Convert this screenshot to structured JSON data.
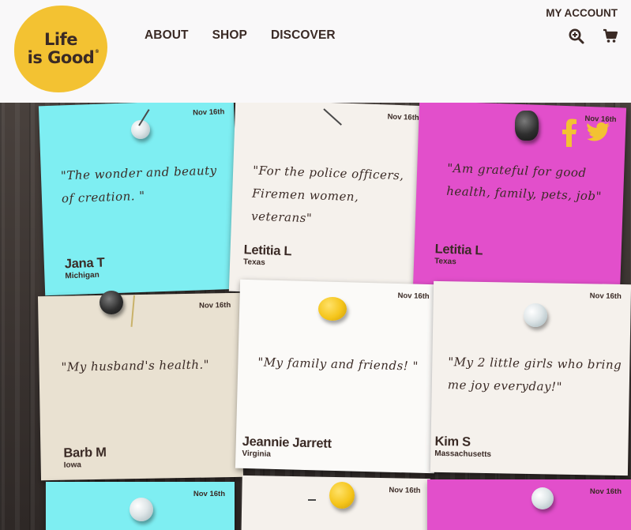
{
  "brand": {
    "line1": "Life",
    "line2": "is Good",
    "tm": "®",
    "color": "#f3c232"
  },
  "nav": {
    "items": [
      "ABOUT",
      "SHOP",
      "DISCOVER"
    ]
  },
  "account": {
    "label": "MY ACCOUNT"
  },
  "icons": {
    "search": "zoom-in-icon",
    "cart": "cart-icon",
    "facebook": "facebook-icon",
    "twitter": "twitter-icon"
  },
  "share_color": "#f3c232",
  "notes": [
    {
      "color": "cyan",
      "date": "Nov 16th",
      "quote": "\"The wonder and beauty of creation. \"",
      "name": "Jana T",
      "state": "Michigan"
    },
    {
      "color": "cream",
      "date": "Nov 16th",
      "quote": "\"For the police officers, Firemen women, veterans\"",
      "name": "Letitia L",
      "state": "Texas"
    },
    {
      "color": "magenta",
      "date": "Nov 16th",
      "quote": "\"Am grateful for good health, family, pets, job\"",
      "name": "Letitia L",
      "state": "Texas"
    },
    {
      "color": "beige",
      "date": "Nov 16th",
      "quote": "\"My husband's health.\"",
      "name": "Barb M",
      "state": "Iowa"
    },
    {
      "color": "white",
      "date": "Nov 16th",
      "quote": "\"My family and friends! \"",
      "name": "Jeannie Jarrett",
      "state": "Virginia"
    },
    {
      "color": "cream",
      "date": "Nov 16th",
      "quote": "\"My 2 little girls who bring me joy everyday!\"",
      "name": "Kim S",
      "state": "Massachusetts"
    },
    {
      "color": "cyan",
      "date": "Nov 16th"
    },
    {
      "color": "cream",
      "date": "Nov 16th"
    },
    {
      "color": "magenta",
      "date": "Nov 16th"
    }
  ]
}
